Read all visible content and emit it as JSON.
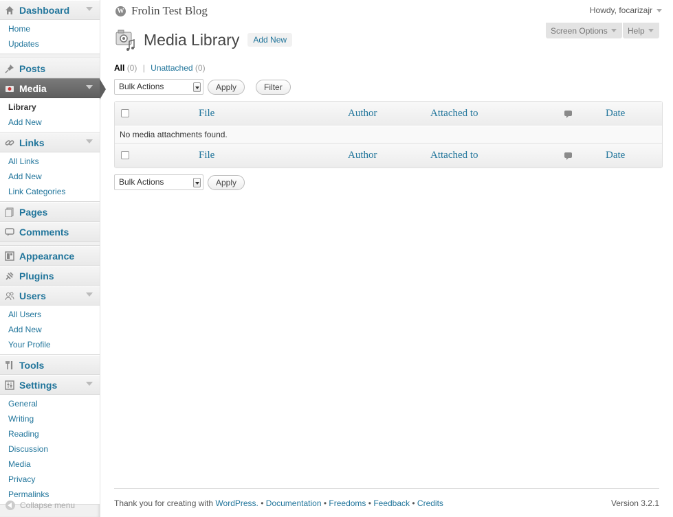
{
  "sidebar": {
    "dashboard": {
      "label": "Dashboard",
      "items": [
        "Home",
        "Updates"
      ]
    },
    "posts": {
      "label": "Posts"
    },
    "media": {
      "label": "Media",
      "items": [
        "Library",
        "Add New"
      ]
    },
    "links": {
      "label": "Links",
      "items": [
        "All Links",
        "Add New",
        "Link Categories"
      ]
    },
    "pages": {
      "label": "Pages"
    },
    "comments": {
      "label": "Comments"
    },
    "appearance": {
      "label": "Appearance"
    },
    "plugins": {
      "label": "Plugins"
    },
    "users": {
      "label": "Users",
      "items": [
        "All Users",
        "Add New",
        "Your Profile"
      ]
    },
    "tools": {
      "label": "Tools"
    },
    "settings": {
      "label": "Settings",
      "items": [
        "General",
        "Writing",
        "Reading",
        "Discussion",
        "Media",
        "Privacy",
        "Permalinks"
      ]
    },
    "collapse_label": "Collapse menu"
  },
  "header": {
    "site_name": "Frolin Test Blog",
    "howdy": "Howdy, focarizajr",
    "screen_options": "Screen Options",
    "help": "Help"
  },
  "main": {
    "title": "Media Library",
    "add_new": "Add New",
    "filters": {
      "all": "All",
      "all_count": "(0)",
      "separator": "|",
      "unattached": "Unattached",
      "unattached_count": "(0)"
    },
    "bulk_actions": "Bulk Actions",
    "apply": "Apply",
    "filter": "Filter",
    "columns": {
      "file": "File",
      "author": "Author",
      "attached_to": "Attached to",
      "date": "Date"
    },
    "empty_message": "No media attachments found."
  },
  "footer": {
    "thanks": "Thank you for creating with",
    "wordpress": "WordPress.",
    "bullet": "•",
    "documentation": "Documentation",
    "freedoms": "Freedoms",
    "feedback": "Feedback",
    "credits": "Credits",
    "version": "Version 3.2.1"
  },
  "colors": {
    "link": "#21759b",
    "current_menu": "#5e5e5e",
    "sidebar_bg": "#f1f1f1"
  },
  "icons": [
    "dashboard-icon",
    "posts-pin-icon",
    "media-icon",
    "links-icon",
    "pages-icon",
    "comments-icon",
    "appearance-icon",
    "plugins-icon",
    "users-icon",
    "tools-icon",
    "settings-icon",
    "wordpress-logo-icon",
    "media-library-icon",
    "comment-bubble-icon"
  ]
}
